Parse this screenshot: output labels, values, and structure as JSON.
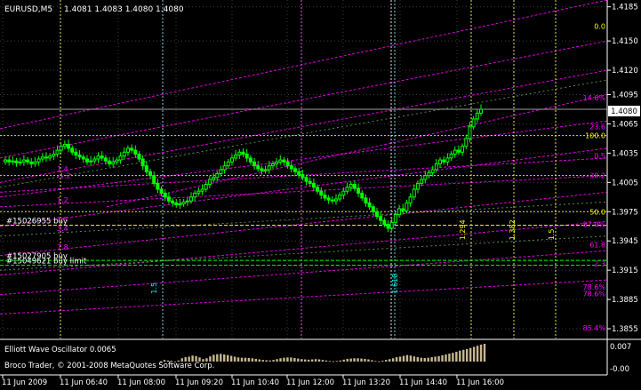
{
  "header": {
    "symbol": "EURUSD,M5",
    "ohlc": "1.4081 1.4083 1.4080 1.4080"
  },
  "price_axis": {
    "ticks": [
      "1.4185",
      "1.4150",
      "1.4120",
      "1.4095",
      "1.4065",
      "1.4035",
      "1.4005",
      "1.3975",
      "1.3945",
      "1.3915",
      "1.3885",
      "1.3855"
    ],
    "current_price": "1.4080",
    "current_price_value": 1.408
  },
  "time_axis": {
    "ticks": [
      "11 Jun 2009",
      "11 Jun 06:40",
      "11 Jun 08:00",
      "11 Jun 09:20",
      "11 Jun 10:40",
      "11 Jun 12:00",
      "11 Jun 13:20",
      "11 Jun 14:40",
      "11 Jun 16:00"
    ]
  },
  "orders": [
    {
      "label": "#15026955 buy",
      "price": 1.3961,
      "color": "#ffff00"
    },
    {
      "label": "#15027905 buy",
      "price": 1.3925,
      "color": "#00ff00"
    },
    {
      "label": "#15049621 buy limit",
      "price": 1.392,
      "color": "#00ff00"
    }
  ],
  "fib_labels_right": [
    {
      "text": "0.0",
      "price": 1.4165
    },
    {
      "text": "14.6%",
      "price": 1.4092
    },
    {
      "text": "23.6",
      "price": 1.4062
    },
    {
      "text": "100.0",
      "price": 1.4053
    },
    {
      "text": "0.5",
      "price": 1.4032
    },
    {
      "text": "38.2",
      "price": 1.4012
    },
    {
      "text": "50.0",
      "price": 1.3975
    },
    {
      "text": "87.9%",
      "price": 1.3962
    },
    {
      "text": "61.8",
      "price": 1.3941
    },
    {
      "text": "2.3",
      "price": 1.3922
    },
    {
      "text": "78.6%",
      "price": 1.3898
    },
    {
      "text": "78.6%",
      "price": 1.3891
    },
    {
      "text": "85.4%",
      "price": 1.3856
    }
  ],
  "fib_labels_left": [
    {
      "text": "1.4",
      "price": 1.4019
    },
    {
      "text": "-1.2",
      "price": 1.4012
    },
    {
      "text": "1.2",
      "price": 1.3987
    },
    {
      "text": "2.5",
      "price": 1.3967
    },
    {
      "text": "3.4",
      "price": 1.3958
    },
    {
      "text": "7.8",
      "price": 1.3939
    }
  ],
  "wave_labels": [
    {
      "text": "1.5",
      "price": 1.39,
      "color": "#00ffff"
    },
    {
      "text": "1.618",
      "price": 1.39,
      "color": "#00ffff"
    },
    {
      "text": "1.294",
      "price": 1.3955,
      "color": "#ffff00"
    },
    {
      "text": "1.382",
      "price": 1.3955,
      "color": "#ffff00"
    },
    {
      "text": "1.5",
      "price": 1.3955,
      "color": "#ffff00"
    }
  ],
  "indicator": {
    "title": "Elliott Wave Oscillator 0.0065",
    "axis_top": "0.007",
    "axis_bottom": "-0.00",
    "values": [
      0.0001,
      0.0006,
      0.0004,
      0.0003,
      -0.0002,
      0.0004,
      0.0012,
      0.0016,
      0.0018,
      0.0022,
      0.002,
      0.0015,
      0.0009,
      0.0012,
      0.0019,
      0.0025,
      0.0027,
      0.0028,
      0.0026,
      0.0024,
      0.0021,
      0.0018,
      0.0015,
      0.0014,
      0.0014,
      0.0013,
      0.0012,
      0.001,
      0.0008,
      0.0006,
      0.0005,
      0.0004,
      0.0006,
      0.0009,
      0.0012,
      0.0014,
      0.0015,
      0.0015,
      0.0013,
      0.0011,
      0.0009,
      0.0008,
      0.0007,
      0.0008,
      0.0009,
      0.0008,
      0.0006,
      0.0004,
      0.0002,
      0.0001,
      0.0002,
      0.0004,
      0.0007,
      0.001,
      0.0011,
      0.0012,
      0.0012,
      0.0011,
      0.001,
      0.0008,
      0.0005,
      0.0002,
      0.0001,
      0.0003,
      0.0006,
      0.0009,
      0.0012,
      0.0016,
      0.0018,
      0.0021,
      0.0024,
      0.0022,
      0.0019,
      0.0016,
      0.0014,
      0.0013,
      0.0014,
      0.0016,
      0.0018,
      0.002,
      0.0023,
      0.0026,
      0.0029,
      0.0032,
      0.0036,
      0.004,
      0.0043,
      0.0046,
      0.005,
      0.0054,
      0.0058,
      0.0062,
      0.0065
    ]
  },
  "copyright": "Broco Trader, © 2001-2008 MetaQuotes Software Corp.",
  "colors": {
    "background": "#000000",
    "candle": "#00ff00",
    "grid": "#3a3a3a",
    "fib_magenta": "#ff00ff",
    "fib_yellow": "#ffff00",
    "time_cyan": "#7ff0ff",
    "time_yellow": "#ffff60",
    "osc_bar": "#c8b890",
    "axis_line": "#ffffff"
  },
  "series_closes": [
    1.4028,
    1.4026,
    1.4027,
    1.4025,
    1.4026,
    1.4028,
    1.4026,
    1.4024,
    1.4026,
    1.4029,
    1.4031,
    1.403,
    1.4032,
    1.4034,
    1.4038,
    1.4042,
    1.4044,
    1.404,
    1.4036,
    1.4033,
    1.4031,
    1.4029,
    1.4026,
    1.4027,
    1.4029,
    1.4032,
    1.403,
    1.4027,
    1.4024,
    1.4026,
    1.4028,
    1.4032,
    1.4036,
    1.404,
    1.4038,
    1.4034,
    1.4029,
    1.4022,
    1.4016,
    1.4012,
    1.4004,
    1.3998,
    1.3994,
    1.399,
    1.3986,
    1.3984,
    1.3982,
    1.3983,
    1.3985,
    1.3986,
    1.399,
    1.3994,
    1.3996,
    1.3998,
    1.4003,
    1.4008,
    1.401,
    1.4014,
    1.4018,
    1.4022,
    1.4026,
    1.403,
    1.4033,
    1.4036,
    1.4034,
    1.403,
    1.4026,
    1.4022,
    1.4019,
    1.4017,
    1.4018,
    1.4022,
    1.4024,
    1.4026,
    1.4028,
    1.4026,
    1.4022,
    1.4019,
    1.4016,
    1.4013,
    1.401,
    1.4006,
    1.4004,
    1.4,
    1.3996,
    1.3992,
    1.3989,
    1.3987,
    1.3986,
    1.3988,
    1.3992,
    1.3996,
    1.4,
    1.4003,
    1.3999,
    1.3994,
    1.3989,
    1.3984,
    1.398,
    1.3975,
    1.397,
    1.3966,
    1.3962,
    1.3958,
    1.3964,
    1.3972,
    1.3978,
    1.3976,
    1.3984,
    1.399,
    1.3998,
    1.4004,
    1.4008,
    1.4012,
    1.4015,
    1.4018,
    1.4024,
    1.4028,
    1.4026,
    1.403,
    1.4034,
    1.4038,
    1.4036,
    1.4042,
    1.405,
    1.4062,
    1.407,
    1.4076,
    1.408
  ]
}
